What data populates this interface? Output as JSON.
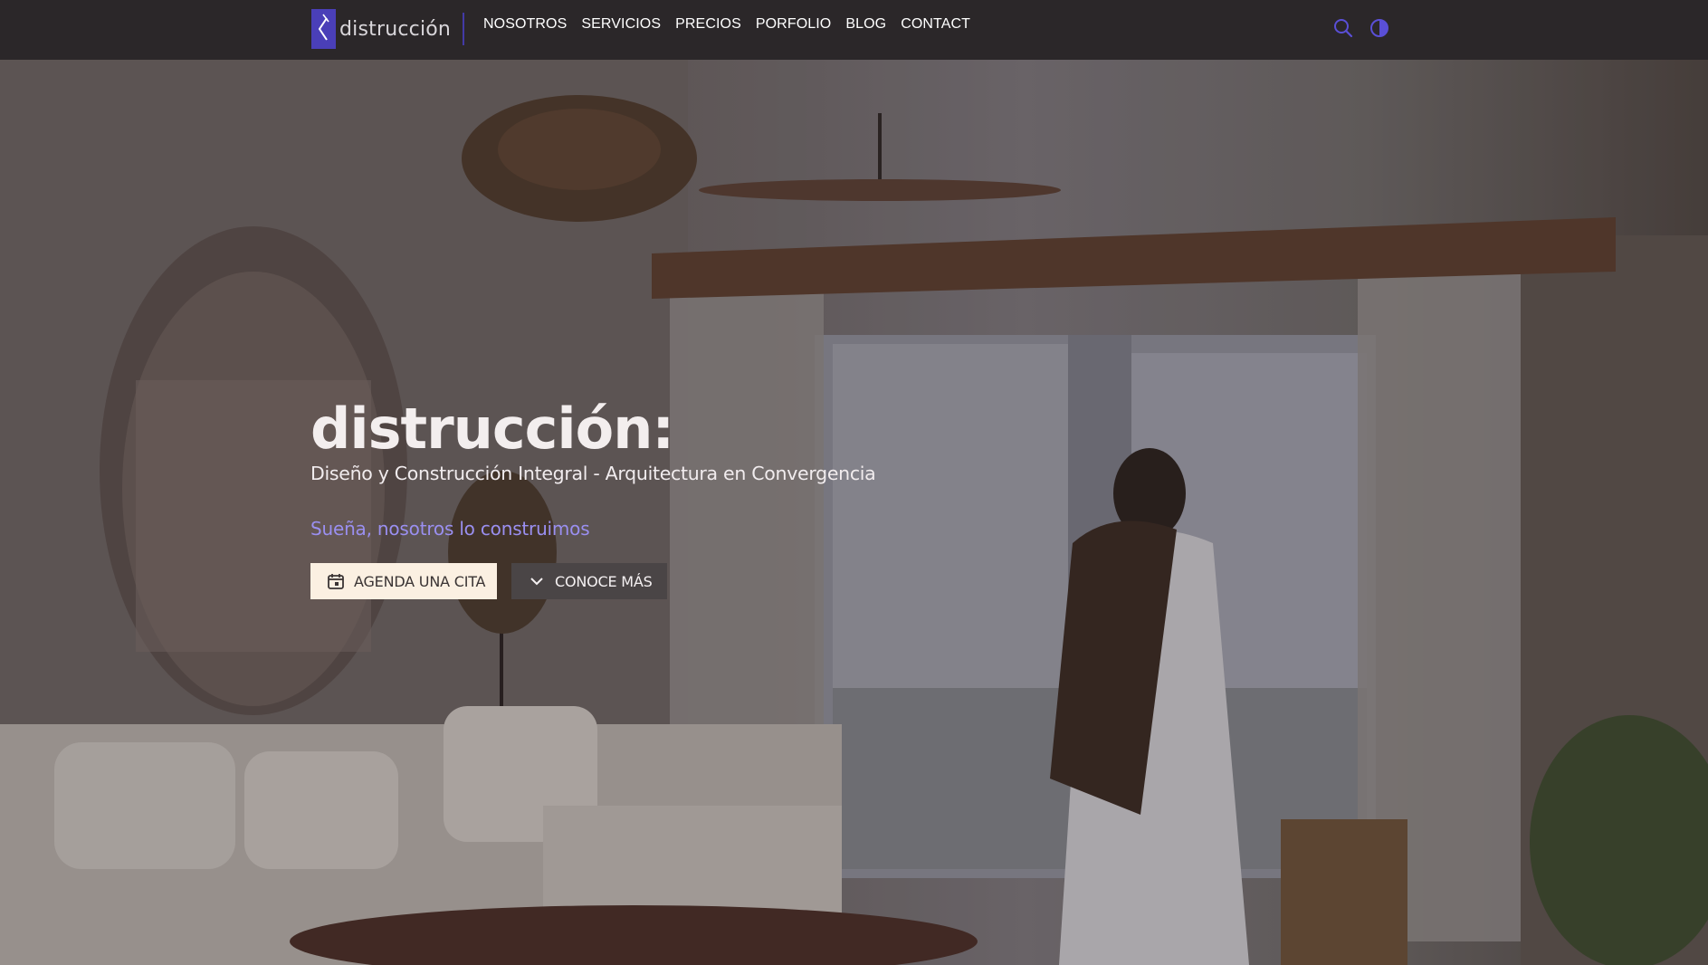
{
  "header": {
    "logo_text": "distrucción",
    "nav": [
      {
        "label": "NOSOTROS"
      },
      {
        "label": "SERVICIOS"
      },
      {
        "label": "PRECIOS"
      },
      {
        "label": "PORFOLIO"
      },
      {
        "label": "BLOG"
      },
      {
        "label": "CONTACT"
      }
    ],
    "icons": {
      "search": "search-icon",
      "theme": "theme-toggle-icon"
    }
  },
  "hero": {
    "title": "distrucción:",
    "subtitle": "Diseño y Construcción Integral - Arquitectura en Convergencia",
    "tagline": "Sueña, nosotros lo construimos",
    "primary_button": {
      "label": "AGENDA UNA CITA",
      "icon": "calendar-icon"
    },
    "secondary_button": {
      "label": "CONOCE MÁS",
      "icon": "chevron-down-icon"
    }
  },
  "colors": {
    "accent": "#4a3fb8",
    "tagline": "#9a8ff0",
    "navbar_bg": "#2b2729",
    "primary_button_bg": "#fbf0e2",
    "secondary_button_bg": "#4a4546"
  }
}
